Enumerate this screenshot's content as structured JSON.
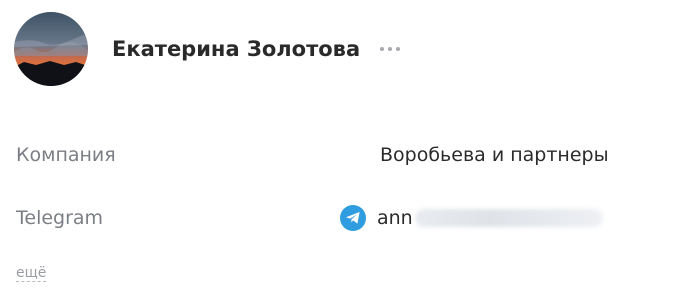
{
  "contact": {
    "name": "Екатерина Золотова",
    "avatar_icon": "sunset-photo-avatar",
    "more_icon": "more-horizontal-icon"
  },
  "fields": {
    "company": {
      "label": "Компания",
      "value": "Воробьева и партнеры"
    },
    "telegram": {
      "label": "Telegram",
      "icon": "telegram-icon",
      "value_visible": "ann",
      "icon_color": "#2f9ddf"
    }
  },
  "more_link": "ещё",
  "colors": {
    "label": "#7b7f85",
    "text": "#2b2b2b",
    "telegram": "#2f9ddf"
  }
}
